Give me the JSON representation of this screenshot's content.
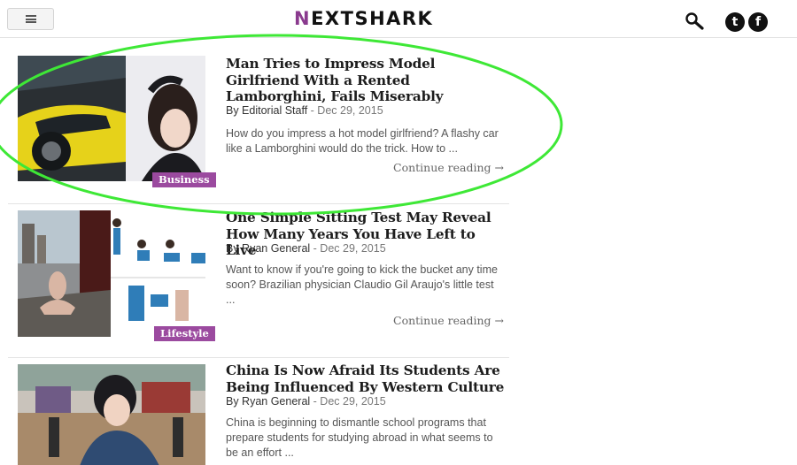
{
  "header": {
    "logo_n": "N",
    "logo_rest": "EXTSHARK",
    "menu_icon": "hamburger-icon",
    "search_icon": "search-icon",
    "social": [
      {
        "icon": "twitter-icon",
        "glyph": "t"
      },
      {
        "icon": "facebook-icon",
        "glyph": "f"
      }
    ]
  },
  "articles": [
    {
      "title": "Man Tries to Impress Model Girlfriend With a Rented Lamborghini, Fails Miserably",
      "author": "By Editorial Staff",
      "date": "- Dec 29, 2015",
      "excerpt": "How do you impress a hot model girlfriend? A flashy car like a Lamborghini would do the trick. How to ...",
      "category": "Business",
      "more": "Continue reading →"
    },
    {
      "title": "One Simple Sitting Test May Reveal How Many Years You Have Left to Live",
      "author": "By Ryan General",
      "date": "- Dec 29, 2015",
      "excerpt": "Want to know if you're going to kick the bucket any time soon? Brazilian physician Claudio Gil Araujo's little test ...",
      "category": "Lifestyle",
      "more": "Continue reading →"
    },
    {
      "title": "China Is Now Afraid Its Students Are Being Influenced By Western Culture",
      "author": "By Ryan General",
      "date": "- Dec 29, 2015",
      "excerpt": "China is beginning to dismantle school programs that prepare students for studying abroad in what seems to be an effort ..."
    }
  ],
  "colors": {
    "brand_purple": "#9b4a9f",
    "highlight_green": "#3ee836",
    "text_dark": "#1d1d1d"
  }
}
